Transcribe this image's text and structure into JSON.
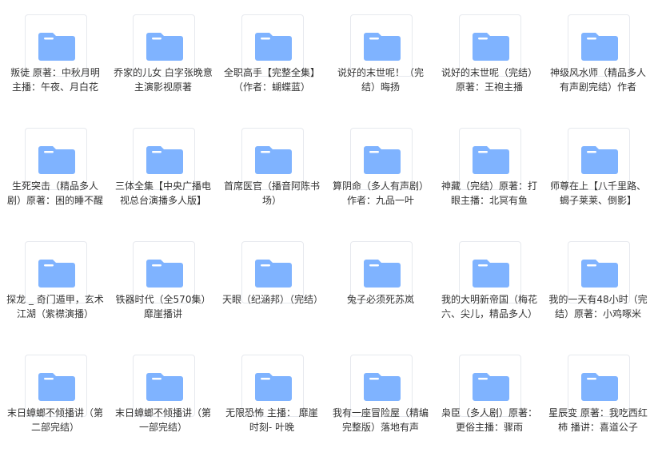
{
  "accent": "#7fb3ff",
  "icon": "folder-icon",
  "items": [
    {
      "label": "叛徒 原著：中秋月明 主播：午夜、月白花"
    },
    {
      "label": "乔家的儿女 白字张晚意主演影视原著"
    },
    {
      "label": "全职高手【完整全集】（作者：蝴蝶蓝）"
    },
    {
      "label": "说好的末世呢！（完结）晦扬"
    },
    {
      "label": "说好的末世呢（完结）原著：王袍主播"
    },
    {
      "label": "神级风水师（精品多人有声剧完结）作者"
    },
    {
      "label": "生死突击（精品多人剧）原著：困的睡不醒"
    },
    {
      "label": "三体全集【中央广播电视总台演播多人版】"
    },
    {
      "label": "首席医官（播音阿陈书场）"
    },
    {
      "label": "算阴命（多人有声剧）作者：九品一叶"
    },
    {
      "label": "神藏（完结）原著：打眼主播：北冥有鱼"
    },
    {
      "label": "师尊在上【八千里路、蝎子莱莱、倒影】"
    },
    {
      "label": "探龙 _ 奇门遁甲，玄术江湖（紫襟演播）"
    },
    {
      "label": "铁器时代（全570集） 靡崖播讲"
    },
    {
      "label": "天眼（纪涵邦）（完结）"
    },
    {
      "label": "兔子必须死苏岚"
    },
    {
      "label": "我的大明新帝国（梅花六、尖儿，精品多人）"
    },
    {
      "label": "我的一天有48小时（完结）原著：小鸡啄米"
    },
    {
      "label": "末日蟑螂不倾播讲（第二部完结）"
    },
    {
      "label": "末日蟑螂不倾播讲（第一部完结）"
    },
    {
      "label": "无限恐怖 主播： 靡崖时刻- 叶晚"
    },
    {
      "label": "我有一座冒险屋（精编完整版）落地有声"
    },
    {
      "label": "枭臣（多人剧）原著：更俗主播：骤雨"
    },
    {
      "label": "星辰变 原著：我吃西红柿 播讲：喜道公子"
    }
  ]
}
